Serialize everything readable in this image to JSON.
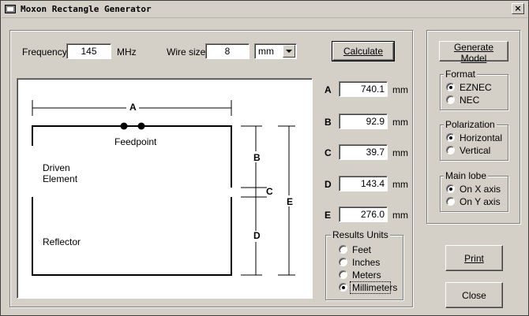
{
  "window": {
    "title": "Moxon Rectangle Generator",
    "close_glyph": "×",
    "icon": "app-window-icon"
  },
  "inputs": {
    "frequency_label": "Frequency",
    "frequency_value": "145",
    "frequency_unit": "MHz",
    "wire_label": "Wire size",
    "wire_value": "8",
    "wire_unit_selected": "mm"
  },
  "buttons": {
    "calculate": "Calculate",
    "generate_model": "Generate Model",
    "print": "Print",
    "close": "Close"
  },
  "drawing": {
    "label_A": "A",
    "label_B": "B",
    "label_C": "C",
    "label_D": "D",
    "label_E": "E",
    "feedpoint": "Feedpoint",
    "driven_line1": "Driven",
    "driven_line2": "Element",
    "reflector": "Reflector"
  },
  "results": {
    "unit": "mm",
    "rows": [
      {
        "label": "A",
        "value": "740.1"
      },
      {
        "label": "B",
        "value": "92.9"
      },
      {
        "label": "C",
        "value": "39.7"
      },
      {
        "label": "D",
        "value": "143.4"
      },
      {
        "label": "E",
        "value": "276.0"
      }
    ]
  },
  "results_units": {
    "title": "Results Units",
    "options": [
      "Feet",
      "Inches",
      "Meters",
      "Millimeters"
    ],
    "selected": "Millimeters"
  },
  "format": {
    "title": "Format",
    "options": [
      "EZNEC",
      "NEC"
    ],
    "selected": "EZNEC"
  },
  "polarization": {
    "title": "Polarization",
    "options": [
      "Horizontal",
      "Vertical"
    ],
    "selected": "Horizontal"
  },
  "main_lobe": {
    "title": "Main lobe",
    "options": [
      "On X axis",
      "On Y axis"
    ],
    "selected": "On X axis"
  }
}
